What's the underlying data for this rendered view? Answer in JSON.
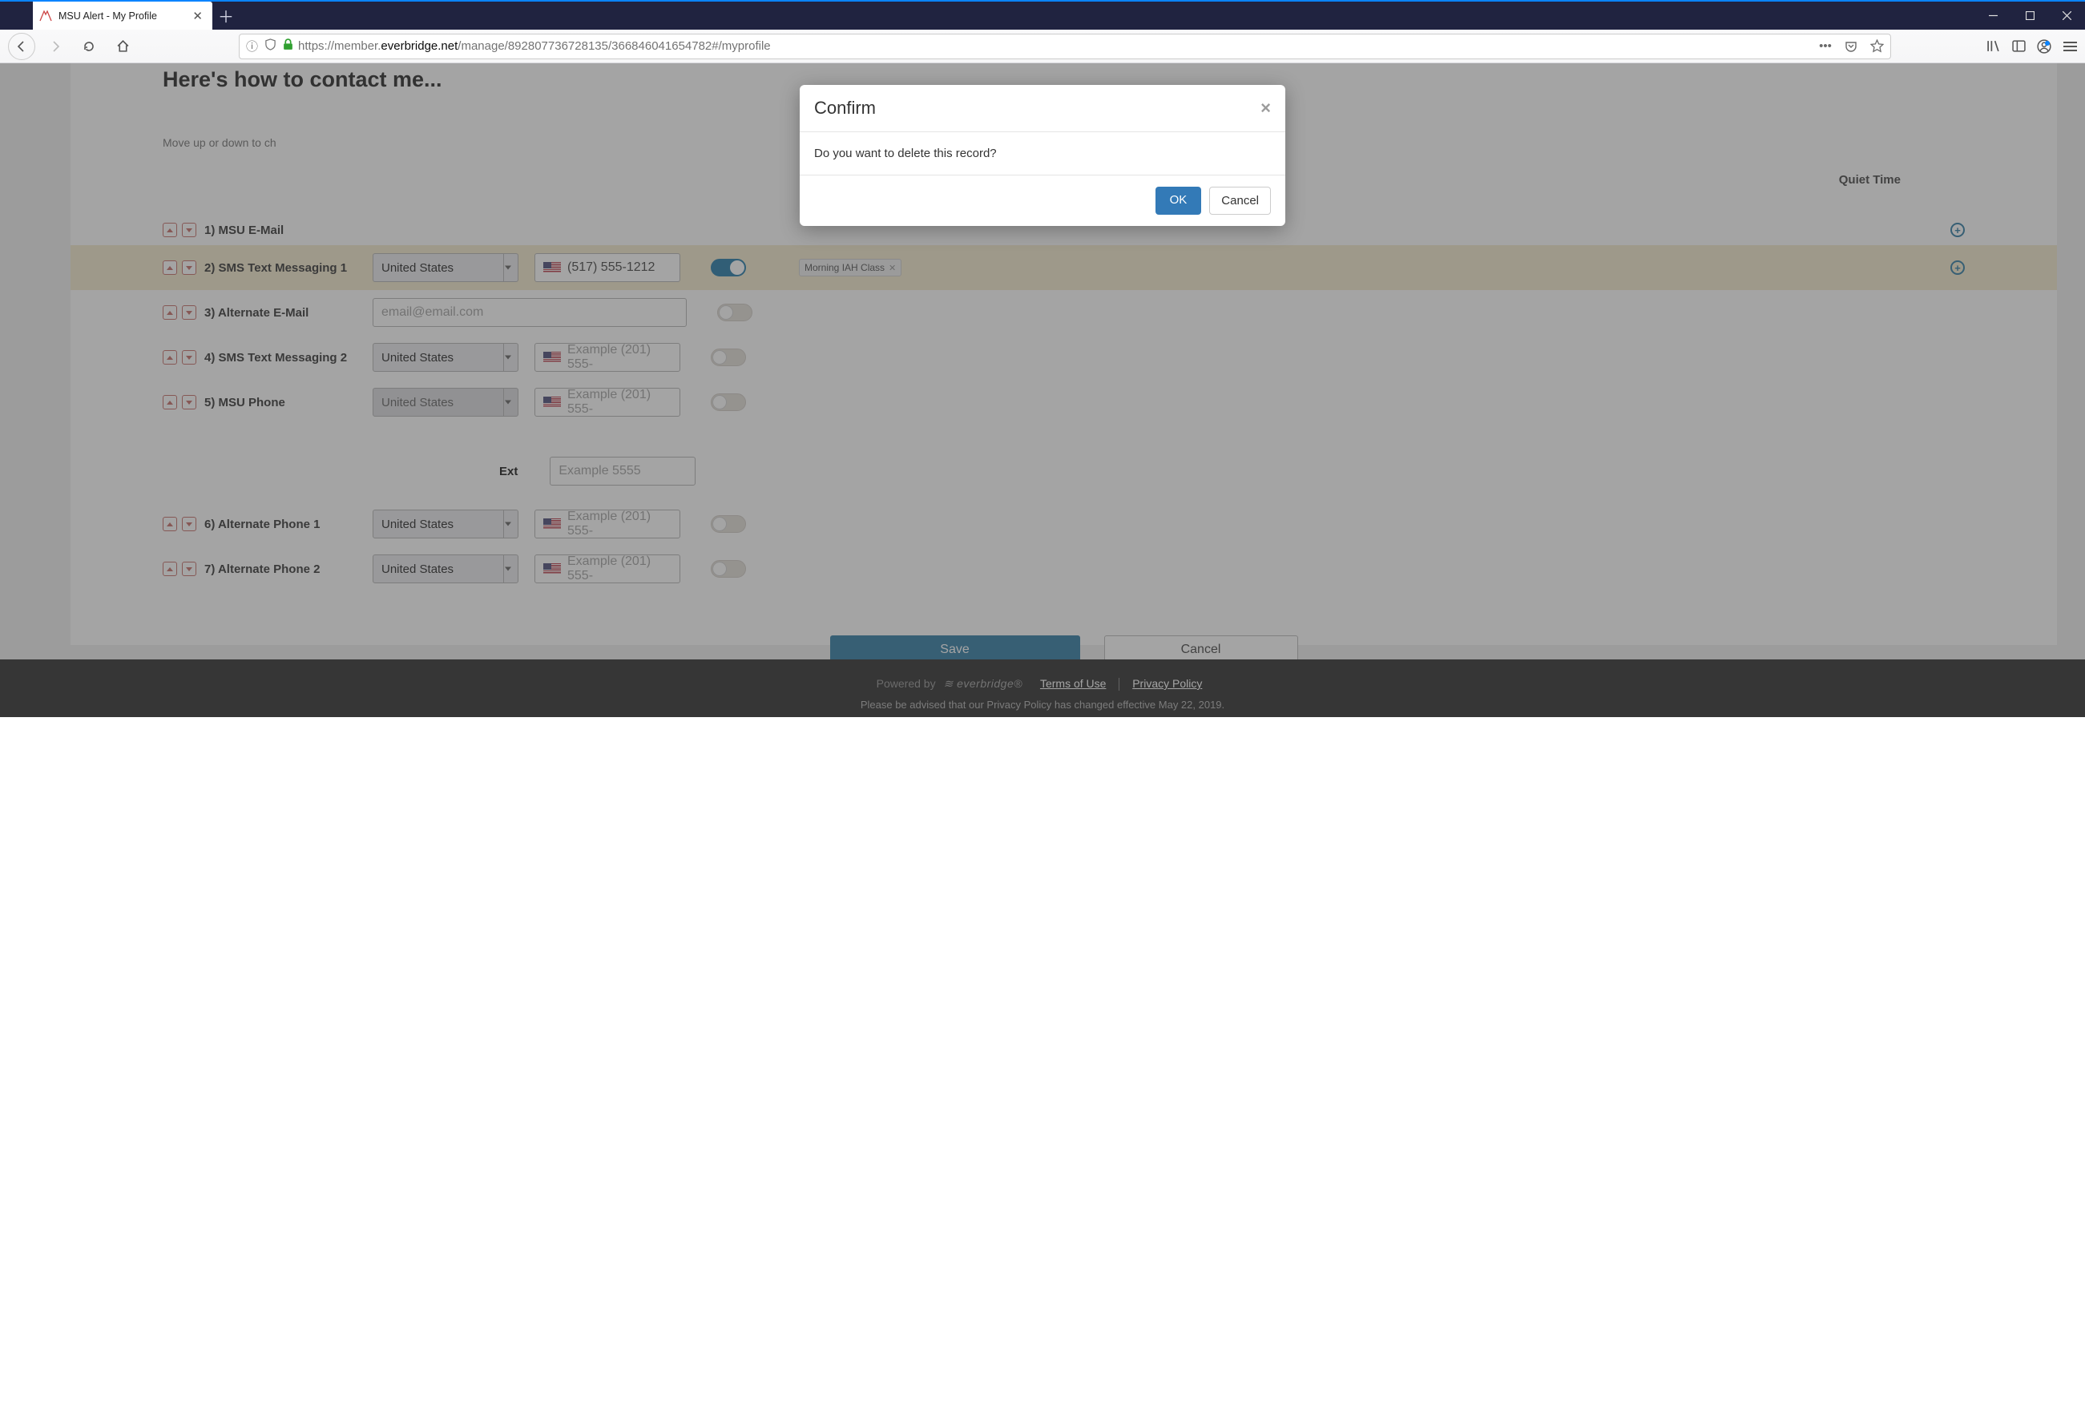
{
  "browser": {
    "tab_title": "MSU Alert - My Profile",
    "url_prefix": "https://member.",
    "url_host": "everbridge.net",
    "url_path": "/manage/892807736728135/366846041654782#/myprofile"
  },
  "page": {
    "heading": "Here's how to contact me...",
    "instruction": "Move up or down to ch",
    "quiet_time_header": "Quiet Time",
    "ext_label": "Ext",
    "ext_placeholder": "Example 5555",
    "save_label": "Save",
    "cancel_label": "Cancel"
  },
  "rows": [
    {
      "label": "1) MSU E-Mail",
      "type": "email-static",
      "has_plus": true
    },
    {
      "label": "2) SMS Text Messaging 1",
      "type": "phone",
      "country": "United States",
      "value": "(517) 555-1212",
      "highlight": true,
      "toggle_on": true,
      "quiet_tag": "Morning IAH Class",
      "has_plus": true
    },
    {
      "label": "3) Alternate E-Mail",
      "type": "email",
      "placeholder": "email@email.com"
    },
    {
      "label": "4) SMS Text Messaging 2",
      "type": "phone",
      "country": "United States",
      "placeholder": "Example (201) 555-"
    },
    {
      "label": "5) MSU Phone",
      "type": "phone",
      "country": "United States",
      "placeholder": "Example (201) 555-",
      "disabled_select": true
    },
    {
      "label": "6) Alternate Phone 1",
      "type": "phone",
      "country": "United States",
      "placeholder": "Example (201) 555-"
    },
    {
      "label": "7) Alternate Phone 2",
      "type": "phone",
      "country": "United States",
      "placeholder": "Example (201) 555-"
    }
  ],
  "modal": {
    "title": "Confirm",
    "body": "Do you want to delete this record?",
    "ok": "OK",
    "cancel": "Cancel"
  },
  "footer": {
    "powered_by": "Powered by",
    "brand": "everbridge®",
    "terms": "Terms of Use",
    "privacy": "Privacy Policy",
    "disclaimer": "Please be advised that our Privacy Policy has changed effective May 22, 2019."
  }
}
